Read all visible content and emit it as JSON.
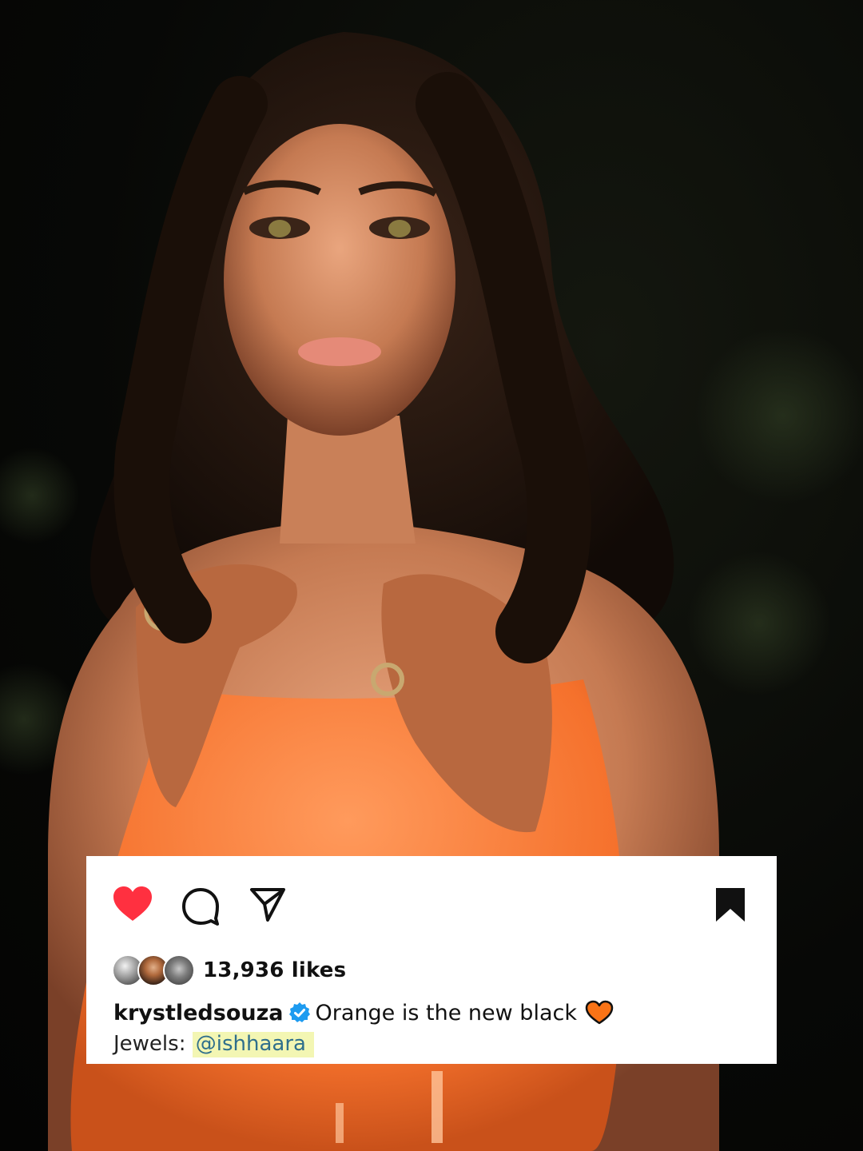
{
  "post": {
    "likes_text": "13,936 likes",
    "username": "krystledsouza",
    "caption": "Orange is the new black",
    "jewels_label": "Jewels:",
    "mention": "@ishhaara"
  },
  "icons": {
    "like": "heart-filled-icon",
    "comment": "speech-bubble-icon",
    "share": "paper-plane-icon",
    "save": "bookmark-filled-icon",
    "verified": "verified-badge-icon",
    "caption_emoji": "orange-heart-icon"
  },
  "colors": {
    "like_red": "#ff3040",
    "verified_blue": "#1d9bf0",
    "orange_heart": "#f97316",
    "mention_highlight": "#f3f6b3",
    "mention_text": "#2f6f8c"
  }
}
